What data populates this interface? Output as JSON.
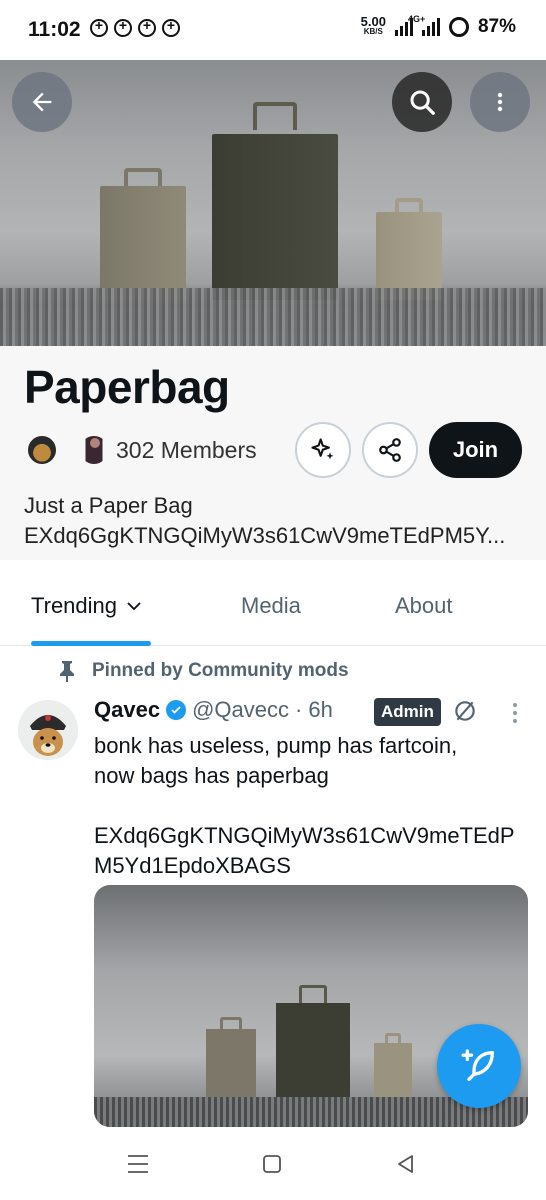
{
  "status_bar": {
    "time": "11:02",
    "net_speed_value": "5.00",
    "net_speed_unit": "KB/S",
    "network_type": "4G+",
    "battery": "87%"
  },
  "community": {
    "name": "Paperbag",
    "members": "302 Members",
    "join_label": "Join",
    "description_line1": "Just a Paper Bag",
    "description_line2": "EXdq6GgKTNGQiMyW3s61CwV9meTEdPM5Y..."
  },
  "tabs": [
    {
      "label": "Trending",
      "active": true
    },
    {
      "label": "Media",
      "active": false
    },
    {
      "label": "About",
      "active": false
    }
  ],
  "post": {
    "pinned_label": "Pinned by Community mods",
    "author_name": "Qavec",
    "author_handle": "@Qavecc",
    "time": "· 6h",
    "badge": "Admin",
    "text_line1": "bonk has useless, pump has fartcoin,",
    "text_line2": "now bags has paperbag",
    "text_line3": "EXdq6GgKTNGQiMyW3s61CwV9meTEdP",
    "text_line4": "M5Yd1EpdoXBAGS"
  },
  "colors": {
    "accent": "#1d9bf0",
    "text_primary": "#0f1419",
    "text_secondary": "#536471",
    "join_bg": "#0f1419"
  },
  "icons": {
    "back": "arrow-left-icon",
    "search": "search-icon",
    "more": "more-vertical-icon",
    "grok": "sparkle-icon",
    "share": "share-icon",
    "pin": "pin-icon",
    "verified": "verified-badge-icon",
    "muted": "muted-icon",
    "compose": "compose-feather-icon"
  }
}
